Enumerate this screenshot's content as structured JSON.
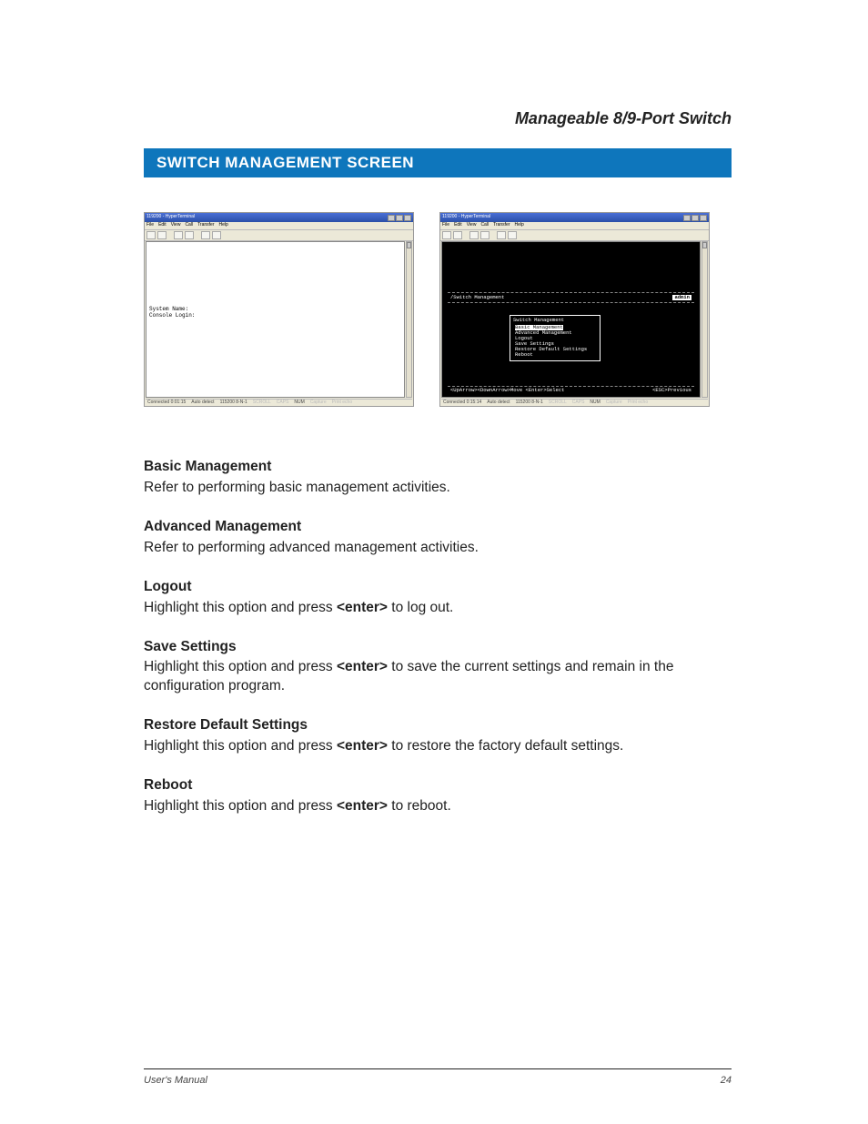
{
  "product_name": "Manageable 8/9-Port Switch",
  "section_title": "SWITCH MANAGEMENT SCREEN",
  "screenshots": {
    "left": {
      "window_title": "119200 - HyperTerminal",
      "menu": [
        "File",
        "Edit",
        "View",
        "Call",
        "Transfer",
        "Help"
      ],
      "terminal_lines": [
        "System Name:",
        "Console Login:"
      ],
      "status": {
        "connected": "Connected 0:01:15",
        "detect": "Auto detect",
        "rate": "115200 8-N-1",
        "scroll": "SCROLL",
        "caps": "CAPS",
        "num": "NUM",
        "capture": "Capture",
        "print": "Print echo"
      }
    },
    "right": {
      "window_title": "119200 - HyperTerminal",
      "menu": [
        "File",
        "Edit",
        "View",
        "Call",
        "Transfer",
        "Help"
      ],
      "header_left": "/Switch Management",
      "header_right": "admin",
      "menu_title": "Switch Management",
      "menu_items": [
        "Basic Management",
        "Advanced Management",
        "Logout",
        "Save Settings",
        "Restore Default Settings",
        "Reboot"
      ],
      "menu_selected_index": 0,
      "footer_left": "<UpArrow><DownArrow>Move  <Enter>Select",
      "footer_right": "<ESC>Previous",
      "status": {
        "connected": "Connected 0:15:14",
        "detect": "Auto detect",
        "rate": "115200 8-N-1",
        "scroll": "SCROLL",
        "caps": "CAPS",
        "num": "NUM",
        "capture": "Capture",
        "print": "Print echo"
      }
    }
  },
  "definitions": [
    {
      "term": "Basic Management",
      "text_before": "Refer to performing basic management activities.",
      "kbd": "",
      "text_after": ""
    },
    {
      "term": "Advanced Management",
      "text_before": "Refer to performing advanced management activities.",
      "kbd": "",
      "text_after": ""
    },
    {
      "term": "Logout",
      "text_before": "Highlight this option and press ",
      "kbd": "<enter>",
      "text_after": " to log out."
    },
    {
      "term": "Save Settings",
      "text_before": "Highlight this option and press ",
      "kbd": "<enter>",
      "text_after": " to save the current settings and remain in the configuration program."
    },
    {
      "term": "Restore Default Settings",
      "text_before": "Highlight this option and press ",
      "kbd": "<enter>",
      "text_after": " to restore the factory default settings."
    },
    {
      "term": "Reboot",
      "text_before": "Highlight this option and press ",
      "kbd": "<enter>",
      "text_after": " to reboot."
    }
  ],
  "footer_left": "User's Manual",
  "footer_right": "24"
}
